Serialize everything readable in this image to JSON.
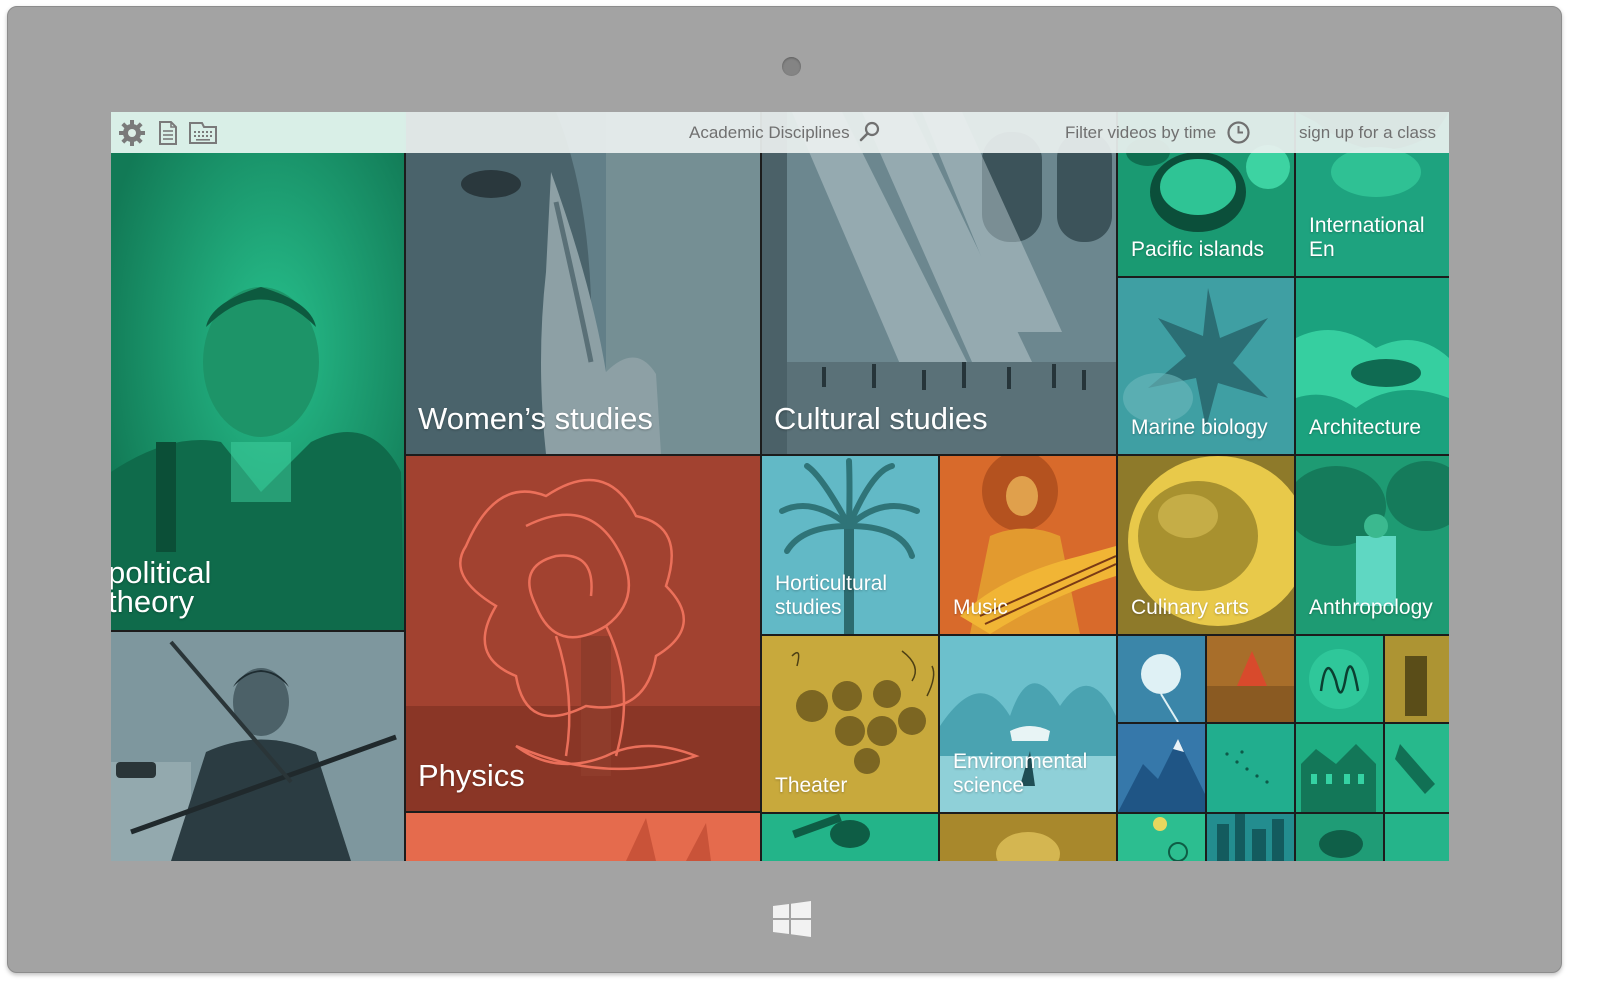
{
  "toolbar": {
    "icons": [
      "gear-icon",
      "document-icon",
      "keyboard-icon"
    ],
    "search_label": "Academic Disciplines",
    "search_icon": "search-icon",
    "filter_label": "Filter videos by time",
    "filter_icon": "clock-icon",
    "signup_label": "sign up for a class"
  },
  "tiles": {
    "political_theory": "political\ntheory",
    "womens_studies": "Women’s studies",
    "cultural_studies": "Cultural studies",
    "pacific_islands": "Pacific islands",
    "international": "International En",
    "marine_biology": "Marine biology",
    "architecture": "Architecture",
    "physics": "Physics",
    "horticultural_studies": "Horticultural\nstudies",
    "music": "Music",
    "culinary_arts": "Culinary arts",
    "anthropology": "Anthropology",
    "theater": "Theater",
    "environmental_science": "Environmental\nscience"
  },
  "colors": {
    "teal": "#1fb487",
    "slate": "#5b7e8a",
    "rust": "#a6432c",
    "sky": "#5cb8c6",
    "mustard": "#c9a83a",
    "orange": "#e6664a",
    "bezel": "#a3a3a3"
  }
}
